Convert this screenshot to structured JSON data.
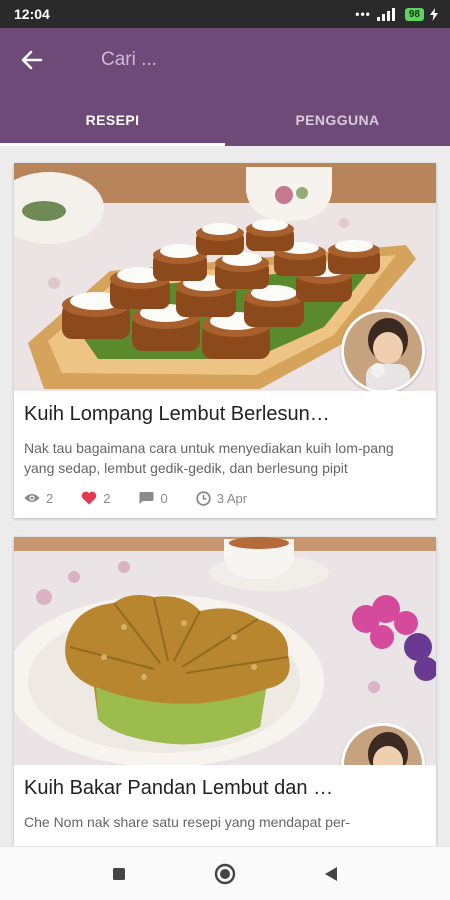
{
  "status_bar": {
    "time": "12:04",
    "battery": "98"
  },
  "search": {
    "placeholder": "Cari ..."
  },
  "tabs": [
    {
      "label": "RESEPI",
      "active": true
    },
    {
      "label": "PENGGUNA",
      "active": false
    }
  ],
  "recipes": [
    {
      "title": "Kuih Lompang Lembut Berlesung Pipit",
      "description": "Nak tau bagaimana cara untuk menyediakan kuih lom-pang yang sedap, lembut gedik-gedik, dan berlesung pipit",
      "views": "2",
      "likes": "2",
      "comments": "0",
      "date": "3 Apr"
    },
    {
      "title": "Kuih Bakar Pandan Lembut dan Sedap",
      "description": "Che Nom nak share satu resepi yang mendapat per-"
    }
  ],
  "icons": {
    "back": "arrow-left-icon",
    "views": "eye-icon",
    "likes": "heart-icon",
    "comments": "chat-icon",
    "date": "clock-icon",
    "nav_recents": "square-icon",
    "nav_home": "circle-icon",
    "nav_back": "triangle-back-icon"
  },
  "colors": {
    "primary": "#6e4a78",
    "like": "#e53950",
    "stat_gray": "#8a8a8a"
  }
}
